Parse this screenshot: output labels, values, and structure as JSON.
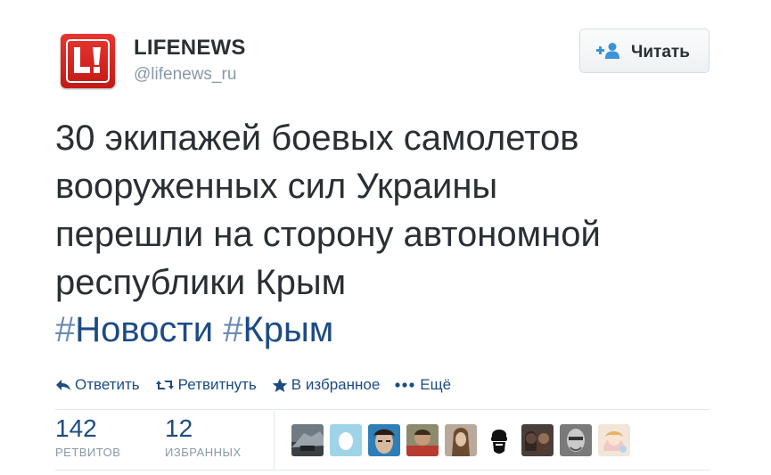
{
  "author": {
    "name": "LIFENEWS",
    "handle": "@lifenews_ru",
    "avatar_icon": "lifenews-logo",
    "brand_color": "#d4241f"
  },
  "follow_button": {
    "label": "Читать",
    "icon": "add-user-icon"
  },
  "tweet": {
    "lines": [
      "30 экипажей боевых самолетов",
      "вооруженных сил Украины",
      "перешли на сторону автономной",
      "республики Крым"
    ],
    "hashtags": [
      {
        "hash": "#",
        "tag": "Новости"
      },
      {
        "hash": "#",
        "tag": "Крым"
      }
    ]
  },
  "actions": {
    "reply": "Ответить",
    "retweet": "Ретвитнуть",
    "favorite": "В избранное",
    "more": "Ещё"
  },
  "stats": {
    "retweets": {
      "value": "142",
      "label": "РЕТВИТОВ"
    },
    "favorites": {
      "value": "12",
      "label": "ИЗБРАННЫХ"
    }
  },
  "colors": {
    "text": "#292f33",
    "link": "#1c4b85",
    "muted": "#8899a6",
    "border": "#e1e8ed"
  },
  "user_avatars": [
    "avatar-1",
    "avatar-2-egg",
    "avatar-3",
    "avatar-4",
    "avatar-5",
    "avatar-6-sunglasses",
    "avatar-7",
    "avatar-8",
    "avatar-9"
  ]
}
